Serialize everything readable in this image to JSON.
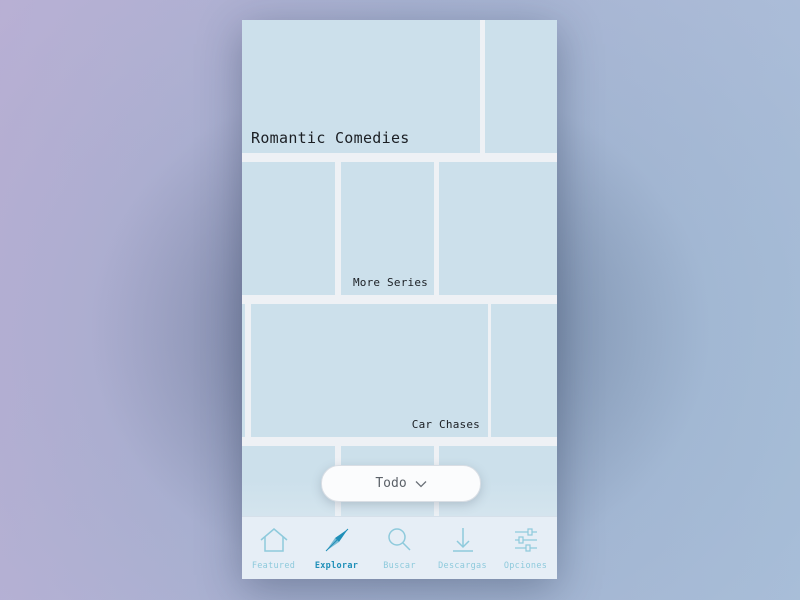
{
  "tiles": {
    "romantic_comedies": "Romantic Comedies",
    "more_series": "More Series",
    "car_chases": "Car Chases"
  },
  "filter": {
    "label": "Todo"
  },
  "tabbar": {
    "items": [
      {
        "label": "Featured",
        "icon": "home-icon"
      },
      {
        "label": "Explorar",
        "icon": "compass-icon",
        "active": true
      },
      {
        "label": "Buscar",
        "icon": "search-icon"
      },
      {
        "label": "Descargas",
        "icon": "download-icon"
      },
      {
        "label": "Opciones",
        "icon": "sliders-icon"
      }
    ]
  },
  "colors": {
    "tile": "#cce0eb",
    "active_tab": "#1f8fb8",
    "inactive_tab": "#8ecadc"
  }
}
